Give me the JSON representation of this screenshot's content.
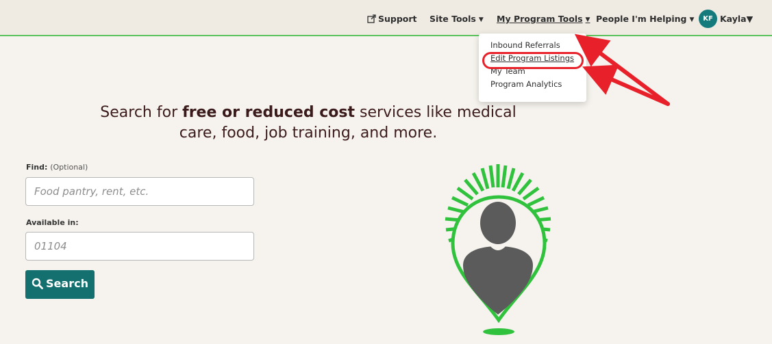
{
  "nav": {
    "support_label": "Support",
    "site_tools_label": "Site Tools",
    "program_tools_label": "My Program Tools",
    "people_label": "People I'm Helping",
    "user": {
      "initials": "KF",
      "name": "Kayla"
    }
  },
  "dropdown": {
    "items": [
      {
        "label": "Inbound Referrals"
      },
      {
        "label": "Edit Program Listings"
      },
      {
        "label": "My Team"
      },
      {
        "label": "Program Analytics"
      }
    ],
    "highlighted": "Edit Program Listings"
  },
  "hero": {
    "title_prefix": "Search for ",
    "title_bold": "free or reduced cost",
    "title_suffix": " services like medical care, food, job training, and more."
  },
  "form": {
    "find_label": "Find:",
    "find_optional": "(Optional)",
    "find_placeholder": "Food pantry, rent, etc.",
    "find_value": "",
    "location_label": "Available in:",
    "location_placeholder": "01104",
    "location_value": "",
    "search_label": "Search"
  },
  "colors": {
    "accent_teal": "#14706f",
    "brand_green": "#31c23d",
    "nav_border": "#5cc35c",
    "annotation_red": "#e8202a"
  },
  "icons": [
    "external-link-icon",
    "caret-down-icon",
    "magnifier-icon",
    "person-location-pin-icon"
  ]
}
